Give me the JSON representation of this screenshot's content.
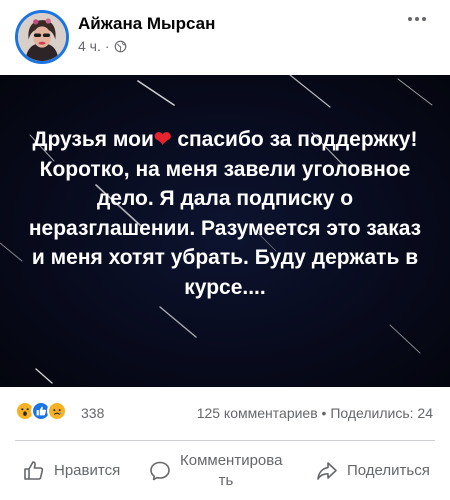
{
  "post": {
    "author": "Айжана Мырсан",
    "time": "4 ч.",
    "separator": "·",
    "image_text": {
      "part1": "Друзья мои",
      "heart": "❤",
      "part2": " спасибо за поддержку! Коротко, на меня завели уголовное дело. Я дала подписку о неразглашении. Разумеется это заказ и меня хотят убрать. Буду держать в курсе...."
    }
  },
  "stats": {
    "reaction_count": "338",
    "comments": "125 комментариев",
    "dot": "•",
    "shares": "Поделились: 24",
    "reactions": [
      "wow-reaction-icon",
      "like-reaction-icon",
      "sad-reaction-icon"
    ]
  },
  "actions": {
    "like": "Нравится",
    "comment": "Комментирова ть",
    "share": "Поделиться"
  },
  "colors": {
    "accent": "#1b74e4",
    "secondary_text": "#65676b",
    "heart": "#e8232f"
  }
}
